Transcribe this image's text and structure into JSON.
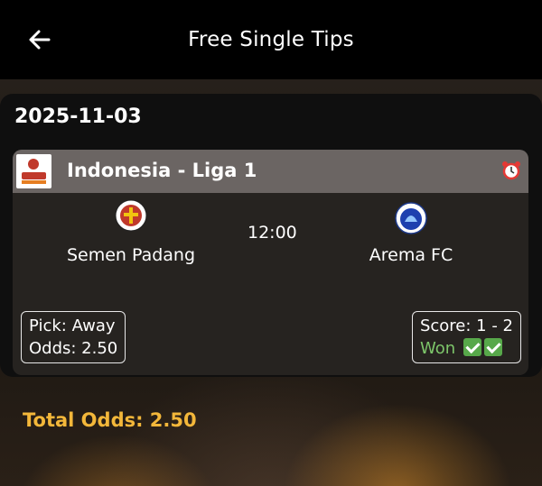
{
  "header": {
    "title": "Free Single Tips"
  },
  "date": "2025-11-03",
  "match": {
    "league": "Indonesia - Liga 1",
    "home_team": "Semen Padang",
    "away_team": "Arema FC",
    "time": "12:00",
    "pick": "Pick: Away",
    "odds": "Odds: 2.50",
    "score": "Score: 1 - 2",
    "result": "Won"
  },
  "footer": {
    "total_odds": "Total Odds: 2.50"
  },
  "icons": {
    "back": "arrow-left-icon",
    "alarm": "alarm-clock-icon",
    "check": "check-mark-icon"
  },
  "colors": {
    "accent": "#f3b73a",
    "won": "#7dc66a",
    "league_bar": "#6b6563"
  }
}
